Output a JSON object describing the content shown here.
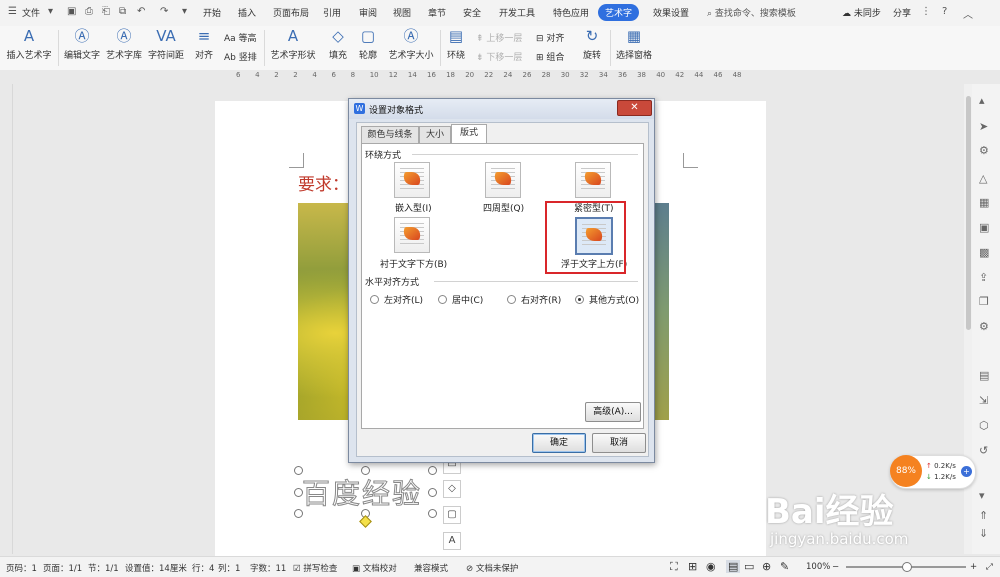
{
  "menubar": {
    "file": "文件",
    "tabs": [
      "开始",
      "插入",
      "页面布局",
      "引用",
      "审阅",
      "视图",
      "章节",
      "安全",
      "开发工具",
      "特色应用",
      "艺术字",
      "效果设置"
    ],
    "active_tab": "艺术字",
    "search": "查找命令、搜索模板",
    "sync": "未同步",
    "share": "分享"
  },
  "ribbon": {
    "insert_art": "插入艺术字",
    "edit_text": "编辑文字",
    "art_lib": "艺术字库",
    "char_spacing": "字符间距",
    "align": "对齐",
    "equal_height": "等高",
    "vertical": "竖排",
    "art_shape": "艺术字形状",
    "fill": "填充",
    "outline": "轮廓",
    "art_size": "艺术字大小",
    "wrap": "环绕",
    "up_one": "上移一层",
    "down_one": "下移一层",
    "align2": "对齐",
    "group": "组合",
    "rotate": "旋转",
    "select_pane": "选择窗格"
  },
  "ruler_ticks": [
    "6",
    "4",
    "2",
    "2",
    "4",
    "6",
    "8",
    "10",
    "12",
    "14",
    "16",
    "18",
    "20",
    "22",
    "24",
    "26",
    "28",
    "30",
    "32",
    "34",
    "36",
    "38",
    "40",
    "42",
    "44",
    "46",
    "48"
  ],
  "document": {
    "heading": "要求：",
    "art_text": "百度经验"
  },
  "dialog": {
    "title": "设置对象格式",
    "tabs": [
      "颜色与线条",
      "大小",
      "版式"
    ],
    "active_tab": "版式",
    "wrap_group": "环绕方式",
    "wrap_options": [
      "嵌入型(I)",
      "四周型(Q)",
      "紧密型(T)",
      "衬于文字下方(B)",
      "浮于文字上方(F)"
    ],
    "selected_wrap": "浮于文字上方(F)",
    "halign_group": "水平对齐方式",
    "halign_options": [
      "左对齐(L)",
      "居中(C)",
      "右对齐(R)",
      "其他方式(O)"
    ],
    "selected_halign": "其他方式(O)",
    "advanced": "高级(A)...",
    "ok": "确定",
    "cancel": "取消"
  },
  "statusbar": {
    "page_num": "页码：1",
    "pages": "页面：1/1",
    "section": "节：1/1",
    "setting": "设置值：14厘米",
    "row": "行：4",
    "col": "列：1",
    "words": "字数：11",
    "spell": "拼写检查",
    "proof": "文档校对",
    "compat": "兼容模式",
    "protect": "文档未保护",
    "zoom": "100%"
  },
  "network_widget": {
    "percent": "88%",
    "up": "0.2K/s",
    "down": "1.2K/s"
  },
  "watermark": {
    "brand": "Bai经验",
    "url": "jingyan.baidu.com"
  },
  "colors": {
    "accent": "#2f6fdf",
    "highlight_box": "#d9262a",
    "heading_red": "#c0392b"
  }
}
